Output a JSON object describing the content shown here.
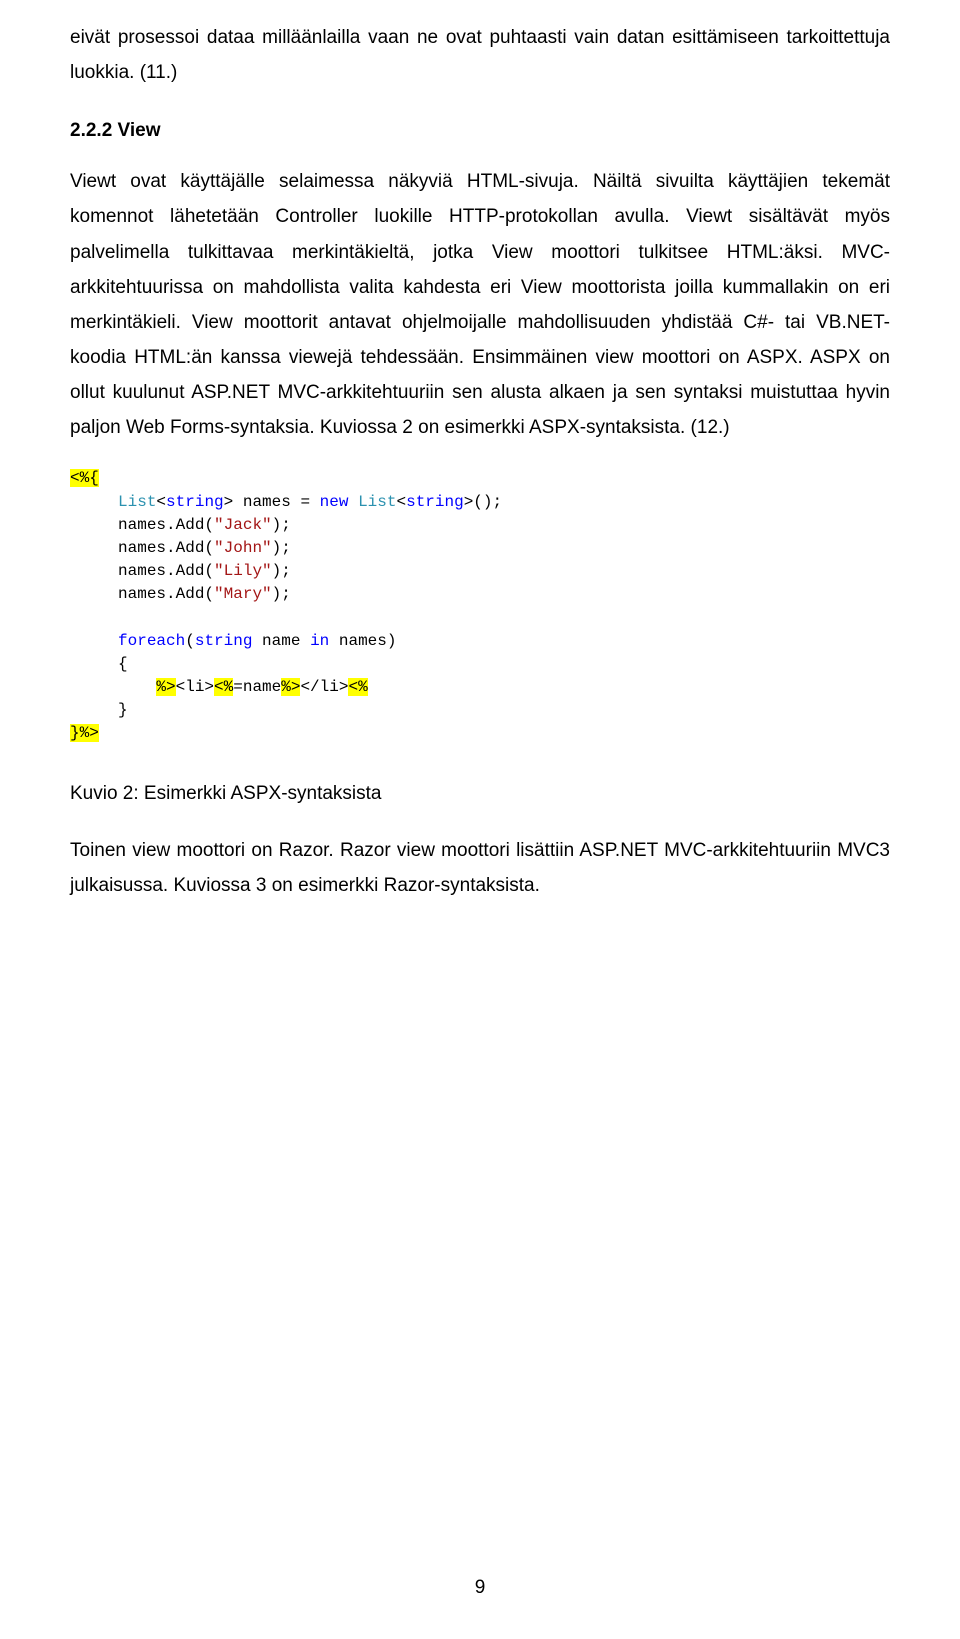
{
  "para1": "eivät prosessoi dataa milläänlailla vaan ne ovat puhtaasti vain datan esittämiseen tarkoittettuja luokkia. (11.)",
  "heading_222": "2.2.2   View",
  "para2": "Viewt ovat käyttäjälle selaimessa näkyviä HTML-sivuja. Näiltä sivuilta käyttäjien tekemät komennot lähetetään Controller luokille HTTP-protokollan avulla. Viewt sisältävät myös palvelimella tulkittavaa merkintäkieltä, jotka View moottori tulkitsee HTML:äksi. MVC-arkkitehtuurissa on mahdollista valita kahdesta eri View moottorista joilla kummallakin on eri merkintäkieli. View moottorit antavat ohjelmoijalle mahdollisuuden yhdistää C#- tai VB.NET-koodia HTML:än kanssa viewejä tehdessään. Ensimmäinen view moottori on ASPX. ASPX on ollut kuulunut ASP.NET MVC-arkkitehtuuriin sen alusta alkaen ja sen syntaksi muistuttaa hyvin paljon Web Forms-syntaksia. Kuviossa 2 on esimerkki ASPX-syntaksista. (12.)",
  "code": {
    "open_tag": "<%{",
    "l1a": "List",
    "l1b": "<",
    "l1c": "string",
    "l1d": "> names = ",
    "l1e": "new",
    "l1f": " ",
    "l1g": "List",
    "l1h": "<",
    "l1i": "string",
    "l1j": ">();",
    "l2a": "names.Add(",
    "l2b": "\"Jack\"",
    "l2c": ");",
    "l3a": "names.Add(",
    "l3b": "\"John\"",
    "l3c": ");",
    "l4a": "names.Add(",
    "l4b": "\"Lily\"",
    "l4c": ");",
    "l5a": "names.Add(",
    "l5b": "\"Mary\"",
    "l5c": ");",
    "l6a": "foreach",
    "l6b": "(",
    "l6c": "string",
    "l6d": " name ",
    "l6e": "in",
    "l6f": " names)",
    "l7": "{",
    "l8a": "%>",
    "l8b": "<li>",
    "l8c": "<%",
    "l8d": "=name",
    "l8e": "%>",
    "l8f": "</li>",
    "l8g": "<%",
    "l9": "}",
    "close_tag": "}%>"
  },
  "caption": "Kuvio 2: Esimerkki ASPX-syntaksista",
  "para3": "Toinen view moottori on Razor. Razor view moottori lisättiin ASP.NET MVC-arkkitehtuuriin MVC3 julkaisussa. Kuviossa 3 on esimerkki Razor-syntaksista.",
  "page_no": "9"
}
